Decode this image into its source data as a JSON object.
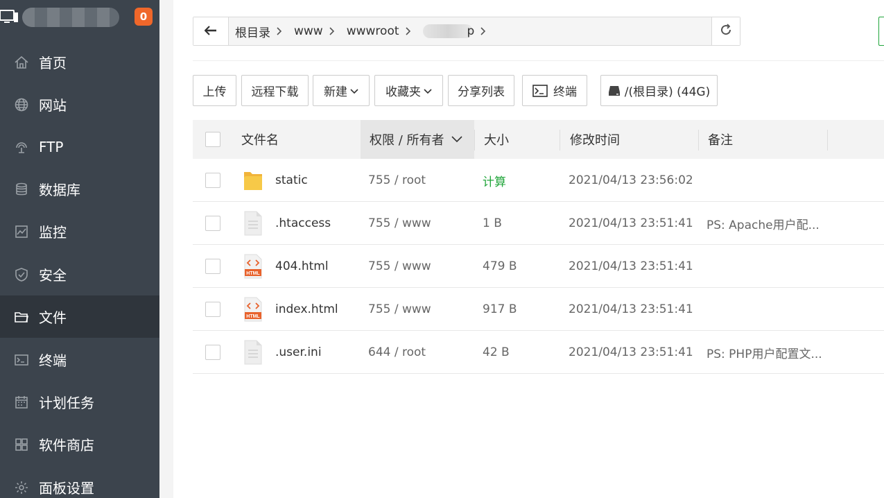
{
  "sidebar": {
    "badge": "0",
    "items": [
      {
        "label": "首页",
        "icon": "home-icon"
      },
      {
        "label": "网站",
        "icon": "globe-icon"
      },
      {
        "label": "FTP",
        "icon": "ftp-icon"
      },
      {
        "label": "数据库",
        "icon": "database-icon"
      },
      {
        "label": "监控",
        "icon": "monitor-chart-icon"
      },
      {
        "label": "安全",
        "icon": "shield-icon"
      },
      {
        "label": "文件",
        "icon": "folder-icon"
      },
      {
        "label": "终端",
        "icon": "terminal-icon"
      },
      {
        "label": "计划任务",
        "icon": "calendar-icon"
      },
      {
        "label": "软件商店",
        "icon": "apps-icon"
      },
      {
        "label": "面板设置",
        "icon": "gear-icon"
      }
    ],
    "active_index": 6
  },
  "path": {
    "crumbs": [
      "根目录",
      "www",
      "wwwroot"
    ],
    "tail": "p"
  },
  "toolbar": {
    "upload": "上传",
    "remote_download": "远程下载",
    "new": "新建",
    "favorites": "收藏夹",
    "share_list": "分享列表",
    "terminal": "终端",
    "disk": "/(根目录) (44G)"
  },
  "table": {
    "headers": {
      "name": "文件名",
      "perm": "权限 / 所有者",
      "size": "大小",
      "mtime": "修改时间",
      "note": "备注"
    },
    "rows": [
      {
        "name": "static",
        "perm": "755 / root",
        "size": "计算",
        "mtime": "2021/04/13 23:56:02",
        "note": "",
        "type": "folder"
      },
      {
        "name": ".htaccess",
        "perm": "755 / www",
        "size": "1 B",
        "mtime": "2021/04/13 23:51:41",
        "note": "PS: Apache用户配...",
        "type": "file"
      },
      {
        "name": "404.html",
        "perm": "755 / www",
        "size": "479 B",
        "mtime": "2021/04/13 23:51:41",
        "note": "",
        "type": "html"
      },
      {
        "name": "index.html",
        "perm": "755 / www",
        "size": "917 B",
        "mtime": "2021/04/13 23:51:41",
        "note": "",
        "type": "html"
      },
      {
        "name": ".user.ini",
        "perm": "644 / root",
        "size": "42 B",
        "mtime": "2021/04/13 23:51:41",
        "note": "PS: PHP用户配置文...",
        "type": "file"
      }
    ]
  },
  "colors": {
    "sidebar_bg": "#3c444d",
    "sidebar_active": "#2f353c",
    "badge": "#f0672a",
    "accent_green": "#20a53a",
    "folder_yellow": "#f7c948",
    "html_orange": "#e8622c"
  }
}
